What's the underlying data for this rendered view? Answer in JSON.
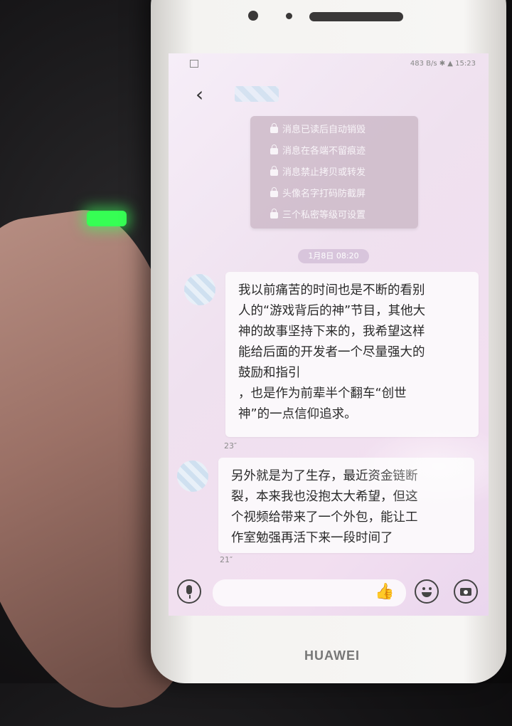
{
  "status_bar": {
    "right_text": "483 B/s ✱ ▲ 15:23"
  },
  "chat": {
    "back_icon": "chevron-left-icon",
    "privacy_notice": [
      "消息已读后自动销毁",
      "消息在各端不留痕迹",
      "消息禁止拷贝或转发",
      "头像名字打码防截屏",
      "三个私密等级可设置"
    ],
    "timestamp": "1月8日 08:20",
    "messages": [
      {
        "text": "我以前痛苦的时间也是不断的看别\n人的“游戏背后的神”节目，其他大\n神的故事坚持下来的，我希望这样\n能给后面的开发者一个尽量强大的\n鼓励和指引\n，也是作为前辈半个翻车“创世\n神”的一点信仰追求。",
        "duration": "23″"
      },
      {
        "text": "另外就是为了生存，最近资金链断\n裂，本来我也没抱太大希望，但这\n个视频给带来了一个外包，能让工\n作室勉强再活下来一段时间了",
        "duration": "21″"
      }
    ]
  },
  "input_bar": {
    "voice_icon": "microphone-icon",
    "thumb_icon": "thumbs-up-icon",
    "emoji_icon": "smiley-icon",
    "camera_icon": "camera-icon"
  },
  "device": {
    "brand": "HUAWEI"
  }
}
